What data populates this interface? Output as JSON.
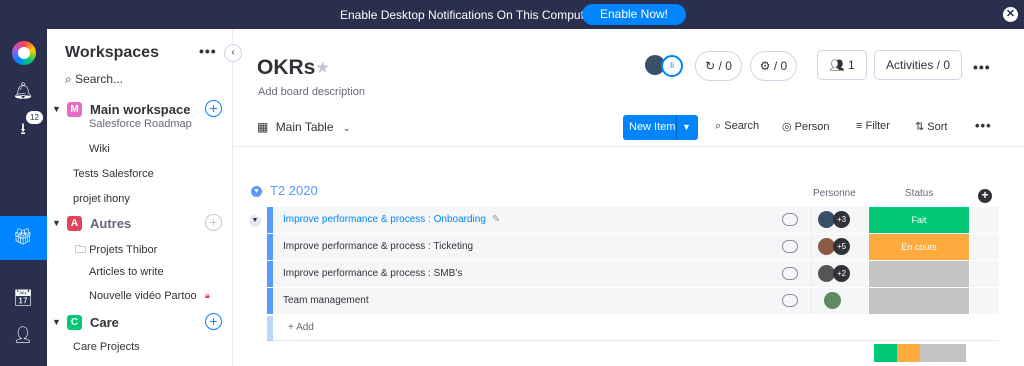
{
  "notification": {
    "message": "Enable Desktop Notifications On This Computer",
    "button": "Enable Now!",
    "close": "✕"
  },
  "rail": {
    "inbox_badge": "12"
  },
  "sidebar": {
    "title": "Workspaces",
    "search_placeholder": "Search...",
    "workspaces": [
      {
        "initial": "M",
        "label": "Main workspace",
        "color": "#e2445c"
      },
      {
        "initial": "A",
        "label": "Autres",
        "color": "#e2445c"
      },
      {
        "initial": "C",
        "label": "Care",
        "color": "#00c875"
      }
    ],
    "items": [
      "Salesforce Roadmap",
      "Wiki",
      "Tests Salesforce",
      "projet ihony",
      "Projets Thibor",
      "Articles to write",
      "Nouvelle vidéo Partoo",
      "Care Projects"
    ]
  },
  "board": {
    "title": "OKRs",
    "description": "Add board description",
    "avatar_tag": "Ii",
    "updates_count": "/ 0",
    "bots_count": "/ 0",
    "members_count": "1",
    "activities": "Activities / 0"
  },
  "toolbar": {
    "view": "Main Table",
    "new_item": "New Item",
    "search": "Search",
    "person": "Person",
    "filter": "Filter",
    "sort": "Sort"
  },
  "group": {
    "name": "T2 2020",
    "color": "#579bfc",
    "columns": {
      "person": "Personne",
      "status": "Status"
    },
    "rows": [
      {
        "name": "Improve performance & process : Onboarding",
        "extra": "+3",
        "status": "Fait",
        "status_color": "#00c875"
      },
      {
        "name": "Improve performance & process : Ticketing",
        "extra": "+5",
        "status": "En cours",
        "status_color": "#fdab3d"
      },
      {
        "name": "Improve performance & process : SMB’s",
        "extra": "+2",
        "status": "",
        "status_color": "#c4c4c4"
      },
      {
        "name": "Team management",
        "extra": "",
        "status": "",
        "status_color": "#c4c4c4"
      }
    ],
    "add_item": "+ Add"
  },
  "status_summary": [
    {
      "label": "Fait",
      "share": 0.25,
      "color": "#00c875"
    },
    {
      "label": "En cours",
      "share": 0.25,
      "color": "#fdab3d"
    },
    {
      "label": "Empty",
      "share": 0.5,
      "color": "#c4c4c4"
    }
  ]
}
